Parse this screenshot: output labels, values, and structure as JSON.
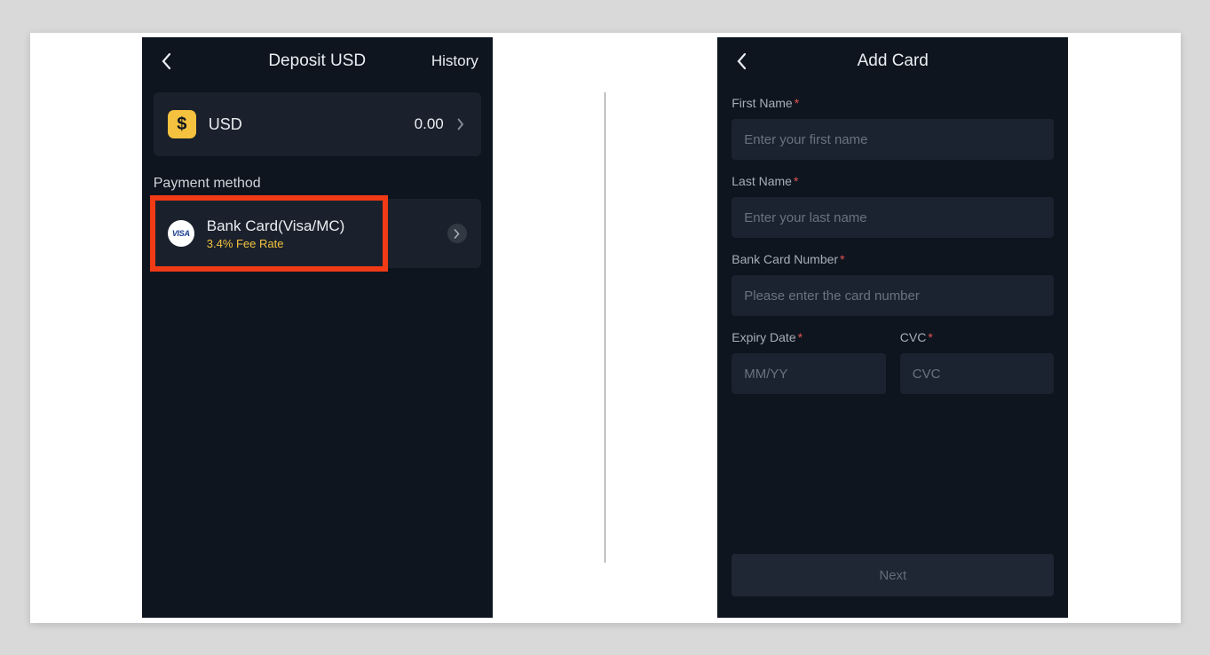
{
  "left": {
    "header": {
      "title": "Deposit USD",
      "right_link": "History"
    },
    "currency": {
      "label": "USD",
      "value": "0.00",
      "icon_glyph": "$"
    },
    "payment_section_title": "Payment method",
    "payment_method": {
      "badge_text": "VISA",
      "name": "Bank Card(Visa/MC)",
      "fee": "3.4% Fee Rate"
    }
  },
  "right": {
    "header": {
      "title": "Add Card"
    },
    "form": {
      "first_name": {
        "label": "First Name",
        "placeholder": "Enter your first name"
      },
      "last_name": {
        "label": "Last Name",
        "placeholder": "Enter your last name"
      },
      "card_number": {
        "label": "Bank Card Number",
        "placeholder": "Please enter the card number"
      },
      "expiry": {
        "label": "Expiry Date",
        "placeholder": "MM/YY"
      },
      "cvc": {
        "label": "CVC",
        "placeholder": "CVC"
      },
      "submit_label": "Next"
    }
  }
}
